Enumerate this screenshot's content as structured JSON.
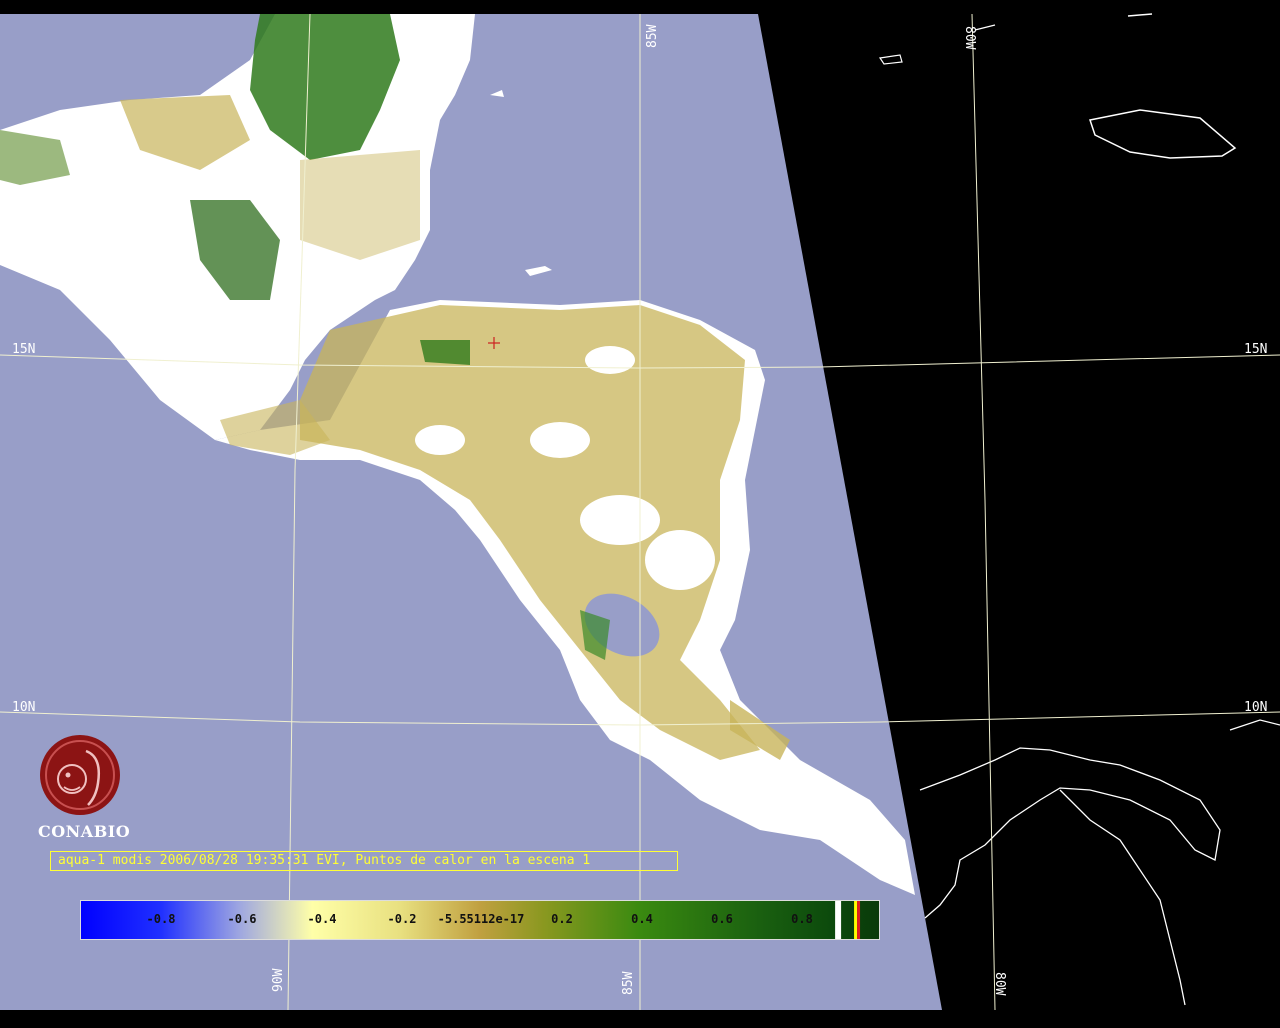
{
  "map": {
    "sensor_caption": "aqua-1 modis 2006/08/28 19:35:31 EVI, Puntos de calor en la escena 1",
    "logo_text": "CONABIO",
    "grid_labels": {
      "lat_15_left": "15N",
      "lat_15_right": "15N",
      "lat_10_left": "10N",
      "lat_10_right": "10N",
      "lon_90_bottom": "90W",
      "lon_85_bottom": "85W",
      "lon_85_top": "85W",
      "lon_80_top": "80W",
      "lon_80_bottom": "80W"
    },
    "colors": {
      "ocean": "#989ec8",
      "outside_swath": "#000000",
      "land_cloud": "#ffffff",
      "vegetation_low": "#c8b45a",
      "vegetation_high": "#1e6e14",
      "grid_line": "#f0f0d0",
      "caption": "#ffff33",
      "logo": "#8c1414"
    }
  },
  "legend": {
    "ticks": [
      "-0.8",
      "-0.6",
      "-0.4",
      "-0.2",
      "-5.55112e-17",
      "0.2",
      "0.4",
      "0.6",
      "0.8"
    ]
  }
}
